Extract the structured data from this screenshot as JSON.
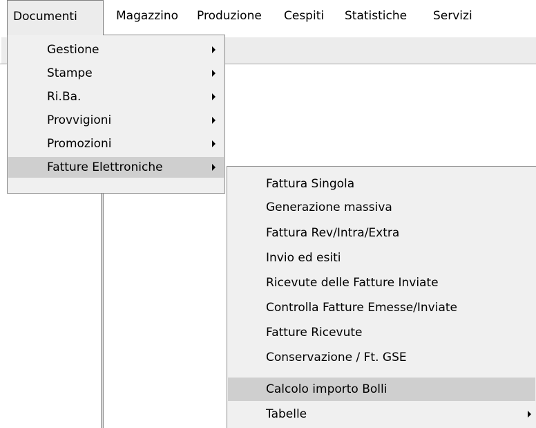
{
  "menubar": {
    "items": [
      {
        "label": "Documenti"
      },
      {
        "label": "Magazzino"
      },
      {
        "label": "Produzione"
      },
      {
        "label": "Cespiti"
      },
      {
        "label": "Statistiche"
      },
      {
        "label": "Servizi"
      }
    ]
  },
  "documenti_menu": {
    "items": [
      {
        "label": "Gestione"
      },
      {
        "label": "Stampe"
      },
      {
        "label": "Ri.Ba."
      },
      {
        "label": "Provvigioni"
      },
      {
        "label": "Promozioni"
      },
      {
        "label": "Fatture Elettroniche"
      }
    ]
  },
  "fatture_elettroniche_menu": {
    "items": [
      {
        "label": "Fattura Singola"
      },
      {
        "label": "Generazione massiva"
      },
      {
        "label": "Fattura Rev/Intra/Extra"
      },
      {
        "label": "Invio ed esiti"
      },
      {
        "label": "Ricevute delle Fatture Inviate"
      },
      {
        "label": "Controlla Fatture Emesse/Inviate"
      },
      {
        "label": "Fatture Ricevute"
      },
      {
        "label": "Conservazione / Ft. GSE"
      },
      {
        "label": "Calcolo importo Bolli"
      },
      {
        "label": "Tabelle"
      }
    ]
  },
  "colors": {
    "menu_background": "#f0f0f0",
    "highlight": "#cfcfcf",
    "open_menubar_item": "#ececec"
  },
  "icons": {
    "submenu_arrow": "right-triangle"
  }
}
